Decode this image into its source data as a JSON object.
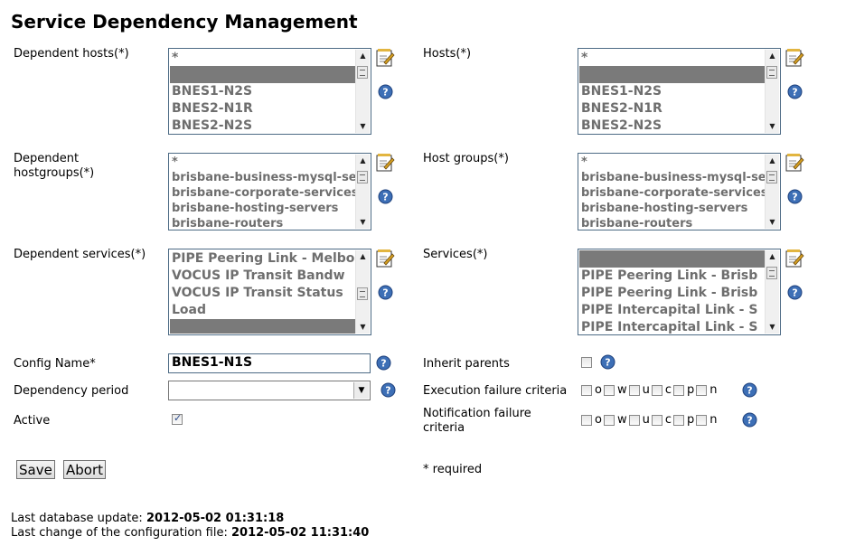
{
  "title": "Service Dependency Management",
  "left": {
    "dependent_hosts": {
      "label": "Dependent hosts(*)",
      "options": [
        "*",
        "",
        "BNES1-N2S",
        "BNES2-N1R",
        "BNES2-N2S"
      ]
    },
    "dependent_hostgroups": {
      "label1": "Dependent",
      "label2": "hostgroups(*)",
      "options": [
        "*",
        "brisbane-business-mysql-se",
        "brisbane-corporate-services",
        "brisbane-hosting-servers",
        "brisbane-routers"
      ]
    },
    "dependent_services": {
      "label": "Dependent services(*)",
      "options": [
        "PIPE Peering Link - Melbo",
        "VOCUS IP Transit Bandw",
        "VOCUS IP Transit Status",
        "Load",
        ""
      ]
    },
    "config_name": {
      "label": "Config Name*",
      "value": "BNES1-N1S"
    },
    "dependency_period": {
      "label": "Dependency period",
      "value": ""
    },
    "active": {
      "label": "Active",
      "checked": true
    }
  },
  "right": {
    "hosts": {
      "label": "Hosts(*)",
      "options": [
        "*",
        "",
        "BNES1-N2S",
        "BNES2-N1R",
        "BNES2-N2S"
      ]
    },
    "host_groups": {
      "label": "Host groups(*)",
      "options": [
        "*",
        "brisbane-business-mysql-se",
        "brisbane-corporate-services",
        "brisbane-hosting-servers",
        "brisbane-routers"
      ]
    },
    "services": {
      "label": "Services(*)",
      "options": [
        "",
        "PIPE Peering Link - Brisb",
        "PIPE Peering Link - Brisb",
        "PIPE Intercapital Link - S",
        "PIPE Intercapital Link - S"
      ]
    },
    "inherit_parents": {
      "label": "Inherit parents"
    },
    "execution_failure": {
      "label": "Execution failure criteria",
      "flags": [
        "o",
        "w",
        "u",
        "c",
        "p",
        "n"
      ]
    },
    "notification_failure": {
      "label1": "Notification failure",
      "label2": "criteria",
      "flags": [
        "o",
        "w",
        "u",
        "c",
        "p",
        "n"
      ]
    },
    "required_note": "* required"
  },
  "buttons": {
    "save": "Save",
    "abort": "Abort"
  },
  "footer": {
    "db_label": "Last database update:",
    "db_value": "2012-05-02 01:31:18",
    "cfg_label": "Last change of the configuration file:",
    "cfg_value": "2012-05-02 11:31:40"
  },
  "icons": {
    "edit": "edit-notepad-icon",
    "help": "help-question-icon"
  }
}
